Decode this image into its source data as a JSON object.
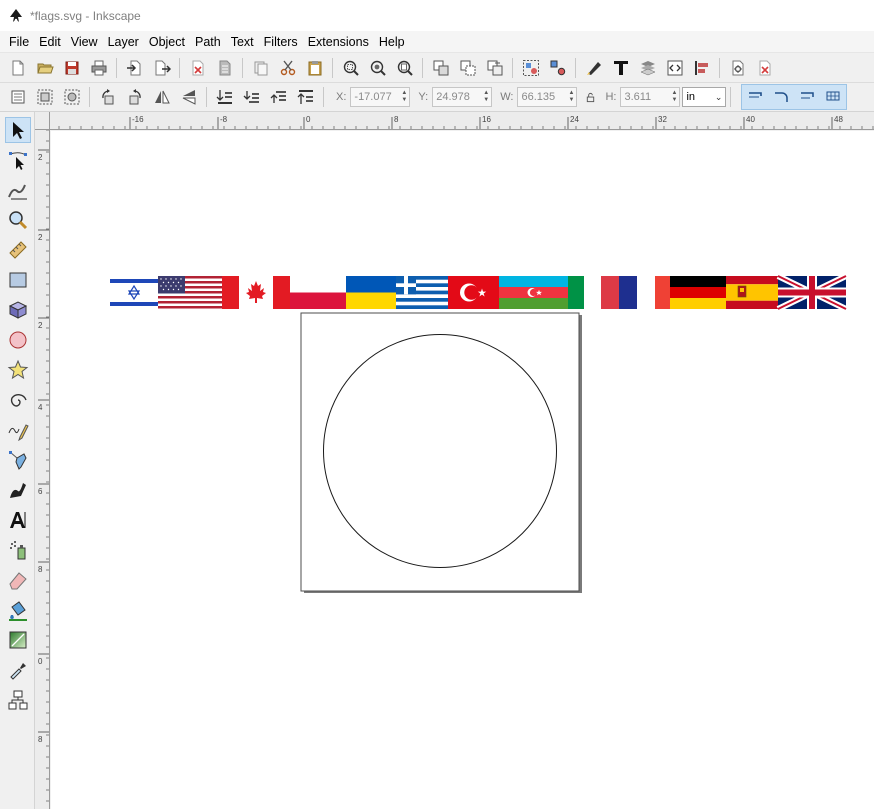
{
  "window": {
    "title": "*flags.svg - Inkscape"
  },
  "menu": [
    {
      "label": "File"
    },
    {
      "label": "Edit"
    },
    {
      "label": "View"
    },
    {
      "label": "Layer"
    },
    {
      "label": "Object"
    },
    {
      "label": "Path"
    },
    {
      "label": "Text"
    },
    {
      "label": "Filters"
    },
    {
      "label": "Extensions"
    },
    {
      "label": "Help"
    }
  ],
  "commands": [
    "new-document-icon",
    "open-icon",
    "save-icon",
    "print-icon",
    "import-icon",
    "export-icon",
    "revert-icon",
    "vacuum-icon",
    "copy-icon",
    "cut-icon",
    "paste-icon",
    "zoom-selection-icon",
    "zoom-drawing-icon",
    "zoom-page-icon",
    "duplicate-icon",
    "clone-icon",
    "unlink-clone-icon",
    "group-icon",
    "ungroup-icon",
    "fill-stroke-icon",
    "text-font-icon",
    "layers-icon",
    "xml-editor-icon",
    "align-distribute-icon",
    "document-properties-icon",
    "preferences-icon"
  ],
  "controls": {
    "x_label": "X:",
    "x_value": "-17.077",
    "y_label": "Y:",
    "y_value": "24.978",
    "w_label": "W:",
    "w_value": "66.135",
    "h_label": "H:",
    "h_value": "3.611",
    "unit": "in"
  },
  "tools": [
    "selector-tool-icon",
    "node-tool-icon",
    "tweak-tool-icon",
    "zoom-tool-icon",
    "measure-tool-icon",
    "rectangle-tool-icon",
    "3d-box-tool-icon",
    "ellipse-tool-icon",
    "star-tool-icon",
    "spiral-tool-icon",
    "pencil-tool-icon",
    "pen-tool-icon",
    "calligraphy-tool-icon",
    "text-tool-icon",
    "spray-tool-icon",
    "eraser-tool-icon",
    "paint-bucket-tool-icon",
    "gradient-tool-icon",
    "dropper-tool-icon",
    "connector-tool-icon"
  ],
  "rulers": {
    "horizontal": [
      "-16",
      "-8",
      "0",
      "8",
      "16",
      "24",
      "32",
      "40",
      "48"
    ],
    "vertical": [
      "2",
      "2",
      "2",
      "4",
      "6",
      "8",
      "0",
      "8",
      "6"
    ]
  },
  "canvas": {
    "flags": [
      "israel-flag",
      "usa-flag",
      "canada-flag",
      "poland-flag",
      "ukraine-flag",
      "greece-flag",
      "turkey-flag",
      "azerbaijan-flag",
      "italy-flag-partial",
      "france-flag",
      "germany-flag",
      "spain-flag",
      "uk-flag"
    ]
  }
}
